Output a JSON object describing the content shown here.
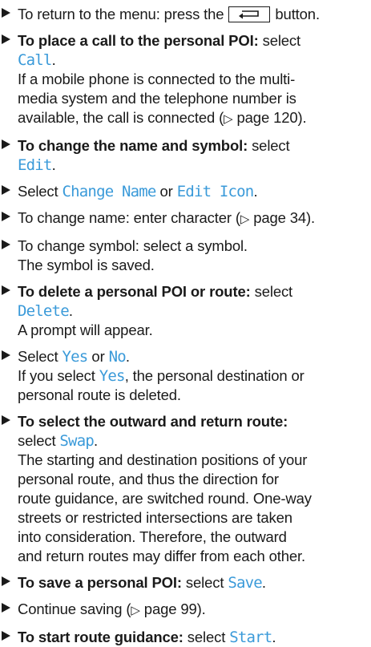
{
  "colors": {
    "ui_text": "#3a9ad9",
    "body_text": "#1a1a1a",
    "background": "#ffffff"
  },
  "icons": {
    "bullet": "right-triangle",
    "back_button": "back-arrow-icon",
    "page_reference": "▷"
  },
  "items": [
    {
      "text_before": "To return to the menu: press the ",
      "text_after": " button."
    },
    {
      "lead": "To place a call to the personal POI:",
      "text": " select ",
      "ui": "Call",
      "end": ".",
      "follow": [
        "If a mobile phone is connected to the multi-",
        "media system and the telephone number is",
        "available, the call is connected ("
      ],
      "ref": "▷",
      "ref_page": " page 120)."
    },
    {
      "lead": "To change the name and symbol:",
      "text": " select",
      "ui": "Edit",
      "end": "."
    },
    {
      "text1": "Select ",
      "ui1": "Change Name",
      "mid": " or ",
      "ui2": "Edit Icon",
      "end": "."
    },
    {
      "text": "To change name: enter character (",
      "ref": "▷",
      "ref_page": " page 34)."
    },
    {
      "line1": "To change symbol: select a symbol.",
      "line2": "The symbol is saved."
    },
    {
      "lead": "To delete a personal POI or route:",
      "text": " select",
      "ui": "Delete",
      "end": ".",
      "follow": "A prompt will appear."
    },
    {
      "text1": "Select ",
      "ui1": "Yes",
      "mid": " or ",
      "ui2": "No",
      "end": ".",
      "follow1a": "If you select ",
      "follow1_ui": "Yes",
      "follow1b": ", the personal destination or",
      "follow2": "personal route is deleted."
    },
    {
      "lead": "To select the outward and return route:",
      "text": "select ",
      "ui": "Swap",
      "end": ".",
      "follow": [
        "The starting and destination positions of your",
        "personal route, and thus the direction for",
        "route guidance, are switched round. One-way",
        "streets or restricted intersections are taken",
        "into consideration. Therefore, the outward",
        "and return routes may differ from each other."
      ]
    },
    {
      "lead": "To save a personal POI:",
      "text": " select ",
      "ui": "Save",
      "end": "."
    },
    {
      "text": "Continue saving (",
      "ref": "▷",
      "ref_page": " page 99)."
    },
    {
      "lead": "To start route guidance:",
      "text": " select ",
      "ui": "Start",
      "end": "."
    }
  ]
}
